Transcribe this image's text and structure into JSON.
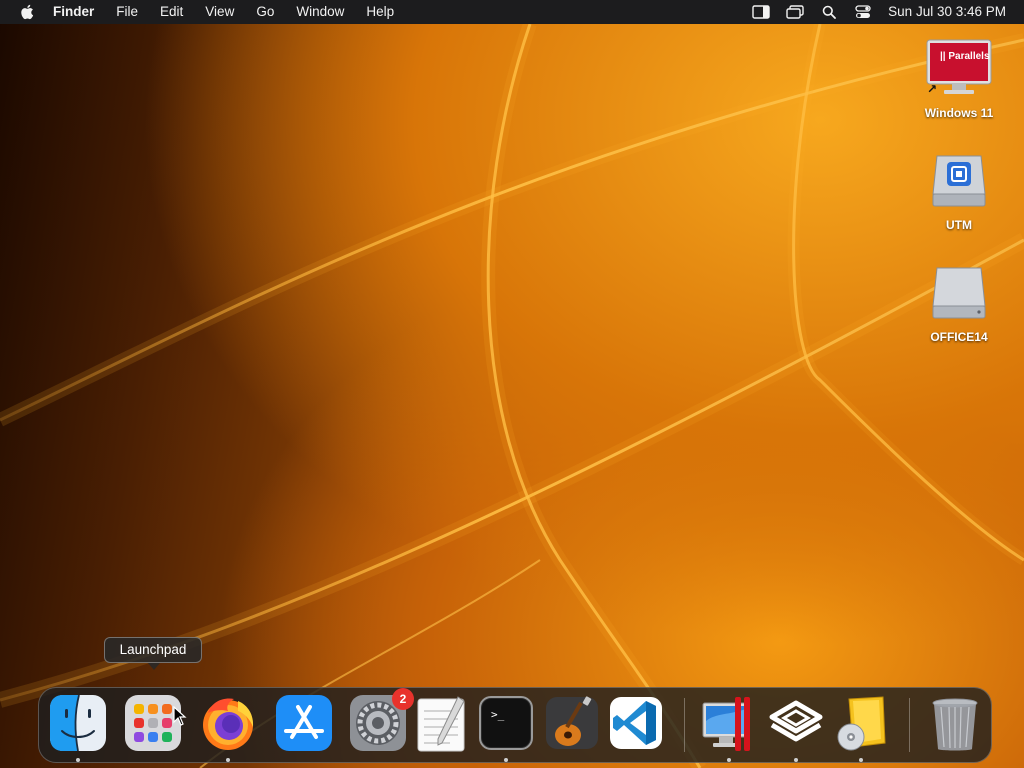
{
  "menubar": {
    "apple_icon": "apple-logo-icon",
    "app_name": "Finder",
    "menus": [
      "File",
      "Edit",
      "View",
      "Go",
      "Window",
      "Help"
    ],
    "status_icons": [
      "sidebar-icon",
      "screen-mirroring-icon",
      "spotlight-search-icon",
      "control-center-icon"
    ],
    "clock": "Sun Jul 30  3:46 PM"
  },
  "desktop": {
    "icons": [
      {
        "label": "Windows 11",
        "icon": "parallels-vm-icon",
        "badge_text": "|| Parallels"
      },
      {
        "label": "UTM",
        "icon": "utm-drive-icon"
      },
      {
        "label": "OFFICE14",
        "icon": "disk-drive-icon"
      }
    ]
  },
  "tooltip": {
    "text": "Launchpad"
  },
  "dock": {
    "items": [
      {
        "name": "Finder",
        "icon": "finder-icon",
        "running": true
      },
      {
        "name": "Launchpad",
        "icon": "launchpad-icon",
        "running": false
      },
      {
        "name": "Firefox",
        "icon": "firefox-icon",
        "running": true
      },
      {
        "name": "App Store",
        "icon": "app-store-icon",
        "running": false
      },
      {
        "name": "System Settings",
        "icon": "system-settings-icon",
        "running": false,
        "badge": "2"
      },
      {
        "name": "TextEdit",
        "icon": "textedit-icon",
        "running": false
      },
      {
        "name": "Terminal",
        "icon": "terminal-icon",
        "running": true,
        "prompt": ">_"
      },
      {
        "name": "GarageBand",
        "icon": "garageband-icon",
        "running": false
      },
      {
        "name": "Visual Studio Code",
        "icon": "vscode-icon",
        "running": false
      },
      {
        "name": "Parallels Desktop",
        "icon": "parallels-desktop-icon",
        "running": true
      },
      {
        "name": "UTM",
        "icon": "utm-icon",
        "running": true
      },
      {
        "name": "Install Office",
        "icon": "office-installer-icon",
        "running": true
      },
      {
        "name": "Trash",
        "icon": "trash-icon",
        "running": false
      }
    ]
  },
  "colors": {
    "menubar_bg": "#1c1c1e",
    "wallpaper_accent": "#f0a020",
    "badge_red": "#e8332c"
  }
}
